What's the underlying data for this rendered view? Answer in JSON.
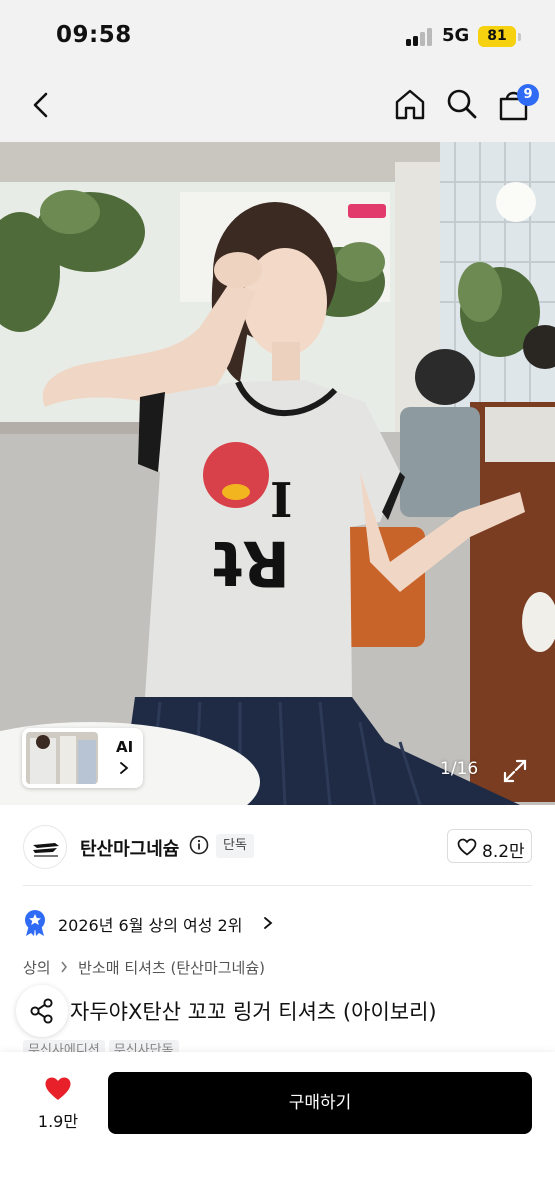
{
  "status_bar": {
    "time": "09:58",
    "network": "5G",
    "battery": "81",
    "battery_color": "#f5d10f"
  },
  "nav": {
    "cart_badge": "9",
    "badge_color": "#2f6bf5",
    "icons": [
      "chevron-left-icon",
      "home-icon",
      "search-icon",
      "cart-icon"
    ]
  },
  "gallery": {
    "current_index": "1",
    "total": "16",
    "counter_sep": "/",
    "ai_label": "AI"
  },
  "brand": {
    "name": "탄산마그네슘",
    "exclusive_label": "단독",
    "likes": "8.2만"
  },
  "ranking": {
    "text": "2026년 6월 상의 여성 2위"
  },
  "breadcrumb": {
    "items": [
      "상의",
      "반소매 티셔츠 (탄산마그네슘)"
    ]
  },
  "product": {
    "title_lead": "[",
    "title": "자두야X탄산 꼬꼬 링거 티셔츠 (아이보리)",
    "tags": [
      "무신사에디션",
      "무신사단독"
    ]
  },
  "bottom_bar": {
    "wish_count": "1.9만",
    "buy_label": "구매하기",
    "heart_color": "#e8202a"
  }
}
